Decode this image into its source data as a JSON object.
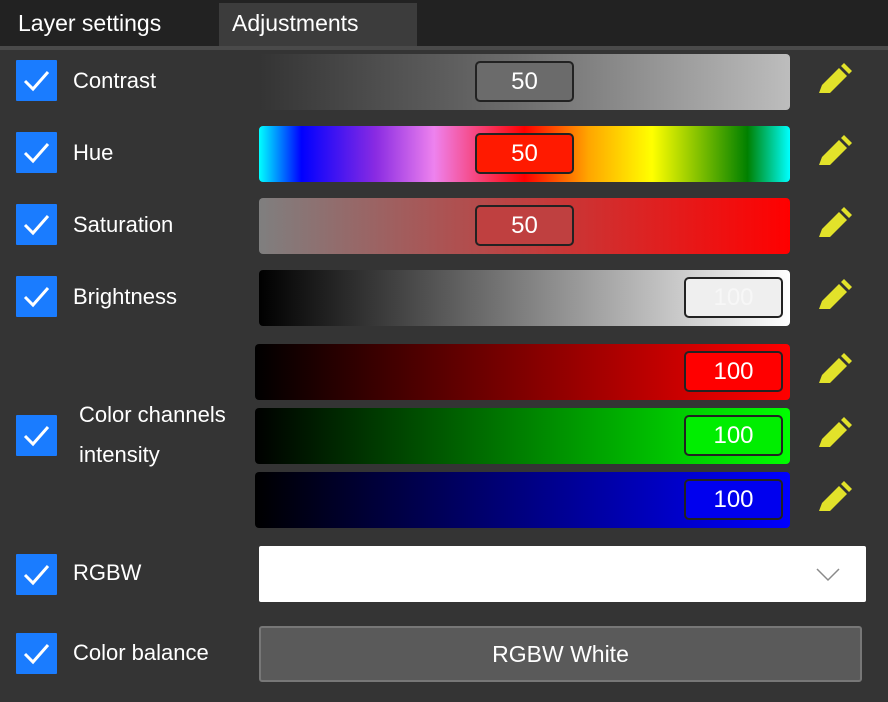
{
  "tabs": [
    {
      "label": "Layer settings",
      "active": false
    },
    {
      "label": "Adjustments",
      "active": true
    }
  ],
  "adjustments": {
    "contrast": {
      "label": "Contrast",
      "checked": true,
      "value": "50",
      "level": 0.5
    },
    "hue": {
      "label": "Hue",
      "checked": true,
      "value": "50",
      "level": 0.5
    },
    "saturation": {
      "label": "Saturation",
      "checked": true,
      "value": "50",
      "level": 0.5
    },
    "brightness": {
      "label": "Brightness",
      "checked": true,
      "value": "100",
      "level": 1.0
    },
    "color_channels": {
      "label_line1": "Color channels",
      "label_line2": "intensity",
      "checked": true,
      "red": {
        "value": "100",
        "level": 1.0,
        "color": "#ff0000"
      },
      "green": {
        "value": "100",
        "level": 1.0,
        "color": "#00ff00"
      },
      "blue": {
        "value": "100",
        "level": 1.0,
        "color": "#0000ff"
      }
    },
    "rgbw": {
      "label": "RGBW",
      "checked": true,
      "selected": ""
    },
    "color_balance": {
      "label": "Color balance",
      "checked": true,
      "button_label": "RGBW White"
    }
  },
  "colors": {
    "checkbox": "#1a7cff",
    "pencil": "#e2e22a",
    "background": "#343434"
  },
  "icons": {
    "checkbox": "check-icon",
    "edit": "pencil-icon",
    "dropdown": "chevron-down-icon"
  }
}
